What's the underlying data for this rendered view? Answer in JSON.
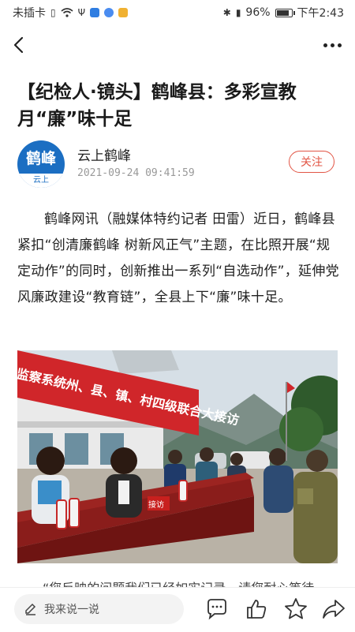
{
  "status_bar": {
    "sim_text": "未插卡",
    "battery_text": "96%",
    "battery_level": 0.96,
    "time": "下午2:43"
  },
  "article": {
    "title": "【纪检人·镜头】鹤峰县：多彩宣教月“廉”味十足",
    "author": {
      "name": "云上鹤峰",
      "avatar_text_top": "鹤峰",
      "avatar_text_bottom": "云上",
      "published": "2021-09-24 09:41:59",
      "follow_label": "关注"
    },
    "paragraph": "鹤峰网讯（融媒体特约记者 田雷）近日，鹤峰县紧扣“创清廉鹤峰 树新风正气”主题，在比照开展“规定动作”的同时，创新推出一系列“自选动作”，延伸党风廉政建设“教育链”，全县上下“廉”味十足。",
    "photo": {
      "banner_text": "监察系统州、县、镇、村四级联合大接访",
      "desk_sign": "接访"
    },
    "next_paragraph_preview": "“您反映的问题我们已经如实记录，请您耐心等待"
  },
  "bottom_bar": {
    "comment_placeholder": "我来说一说",
    "icons": [
      "comment-icon",
      "thumbs-up-icon",
      "star-icon",
      "share-icon"
    ]
  },
  "colors": {
    "accent": "#e25545",
    "avatar_blue": "#1b6ec2"
  }
}
